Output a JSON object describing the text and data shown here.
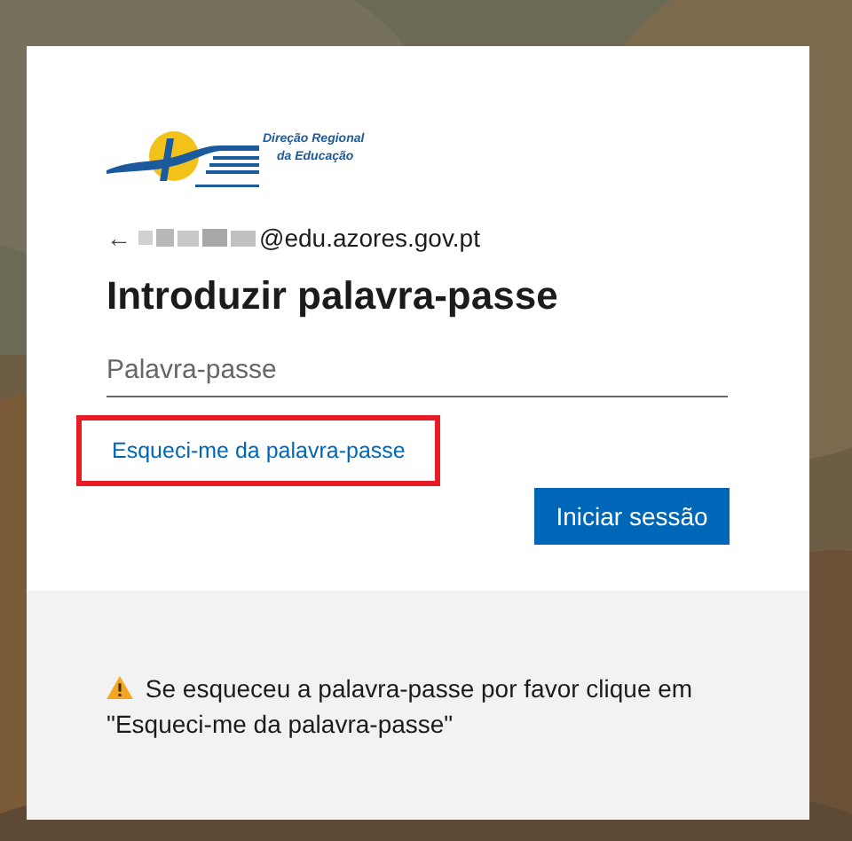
{
  "logo": {
    "line_1": "Direção Regional",
    "line_2": "da Educação"
  },
  "account": {
    "back": "←",
    "email": "@edu.azores.gov.pt"
  },
  "title": "Introduzir palavra-passe",
  "password": {
    "placeholder": "Palavra-passe"
  },
  "forgot_link": {
    "label": "Esqueci-me da palavra-passe",
    "highlighted": true
  },
  "sign_in_button": "Iniciar sessão",
  "notice": {
    "text": "Se esqueceu a palavra-passe por favor clique em \"Esqueci-me da palavra-passe\""
  }
}
